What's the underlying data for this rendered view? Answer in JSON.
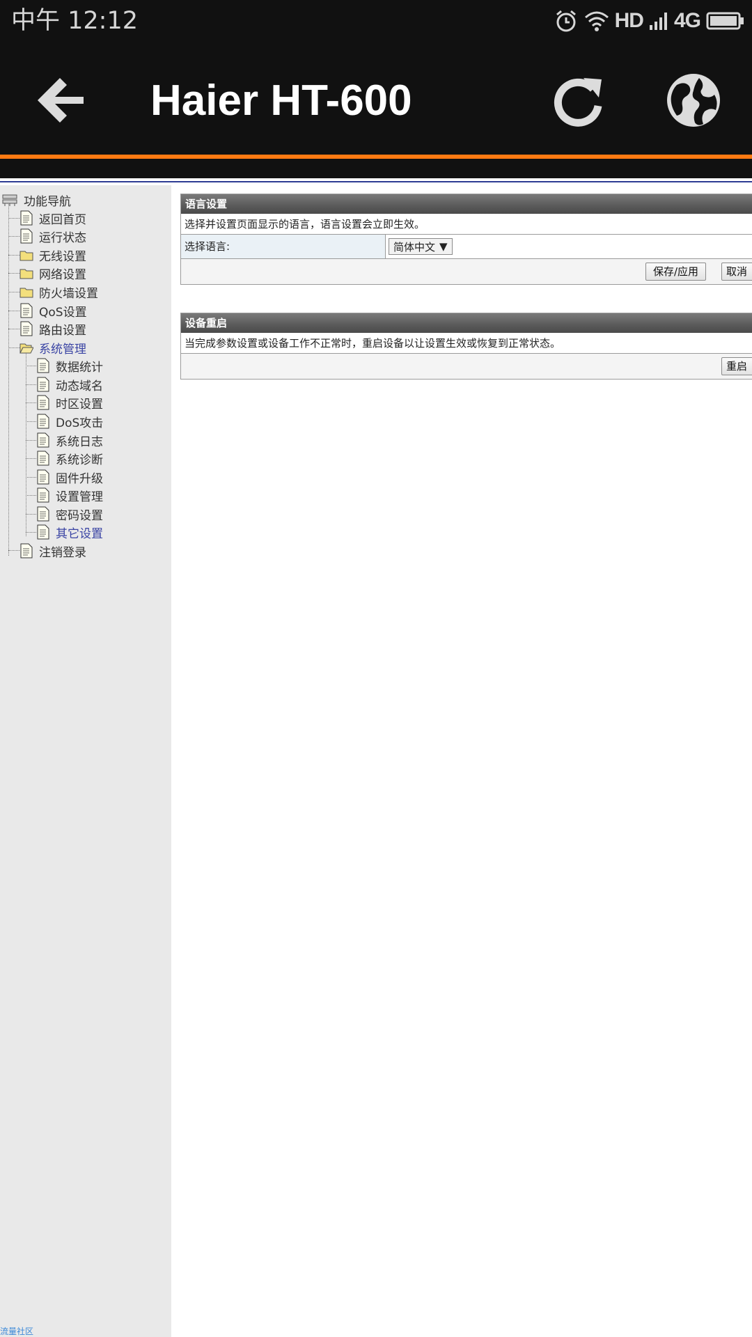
{
  "status_bar": {
    "time": "中午 12:12",
    "hd": "HD",
    "network": "4G"
  },
  "app_bar": {
    "title": "Haier HT-600"
  },
  "nav": {
    "root": "功能导航",
    "items": [
      {
        "label": "返回首页"
      },
      {
        "label": "运行状态"
      },
      {
        "label": "无线设置"
      },
      {
        "label": "网络设置"
      },
      {
        "label": "防火墙设置"
      },
      {
        "label": "QoS设置"
      },
      {
        "label": "路由设置"
      },
      {
        "label": "系统管理"
      },
      {
        "label": "注销登录"
      }
    ],
    "sub_items": [
      {
        "label": "数据统计"
      },
      {
        "label": "动态域名"
      },
      {
        "label": "时区设置"
      },
      {
        "label": "DoS攻击"
      },
      {
        "label": "系统日志"
      },
      {
        "label": "系统诊断"
      },
      {
        "label": "固件升级"
      },
      {
        "label": "设置管理"
      },
      {
        "label": "密码设置"
      },
      {
        "label": "其它设置"
      }
    ],
    "footer": "流量社区"
  },
  "language_panel": {
    "title": "语言设置",
    "description": "选择并设置页面显示的语言，语言设置会立即生效。",
    "field_label": "选择语言:",
    "selected_language": "简体中文",
    "save_label": "保存/应用",
    "cancel_label": "取消"
  },
  "reboot_panel": {
    "title": "设备重启",
    "description": "当完成参数设置或设备工作不正常时，重启设备以让设置生效或恢复到正常状态。",
    "reboot_label": "重启"
  },
  "colors": {
    "accent": "#ff7a12",
    "bar": "#111111",
    "active_link": "#3a44a4",
    "sidebar_bg": "#e9e9e9"
  },
  "icons": {
    "back": "arrow-left-icon",
    "refresh": "refresh-icon",
    "globe": "globe-icon",
    "folder": "folder-icon",
    "page": "page-icon"
  }
}
